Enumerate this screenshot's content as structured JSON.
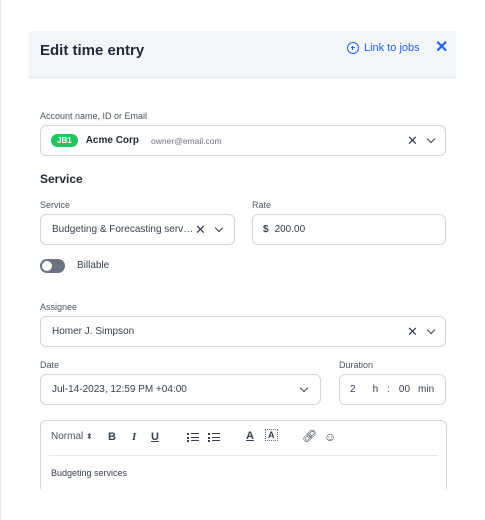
{
  "header": {
    "title": "Edit time entry",
    "link_jobs": "Link to jobs"
  },
  "account": {
    "label": "Account name, ID or Email",
    "badge": "JB1",
    "name": "Acme Corp",
    "email": "owner@email.com"
  },
  "service_section": {
    "title": "Service",
    "service_label": "Service",
    "service_value": "Budgeting & Forecasting services",
    "rate_label": "Rate",
    "rate_currency": "$",
    "rate_value": "200.00",
    "billable_label": "Billable",
    "billable_on": false
  },
  "assignee": {
    "label": "Assignee",
    "value": "Homer J. Simpson"
  },
  "date": {
    "label": "Date",
    "value": "Jul-14-2023, 12:59 PM +04:00"
  },
  "duration": {
    "label": "Duration",
    "hours": "2",
    "h_unit": "h",
    "sep": ":",
    "minutes": "00",
    "min_unit": "min"
  },
  "editor": {
    "format": "Normal",
    "bold": "B",
    "italic": "I",
    "underline": "U",
    "content": "Budgeting services"
  },
  "colors": {
    "accent": "#2563eb",
    "badge": "#22c55e",
    "header_bg": "#f3f6f9"
  }
}
